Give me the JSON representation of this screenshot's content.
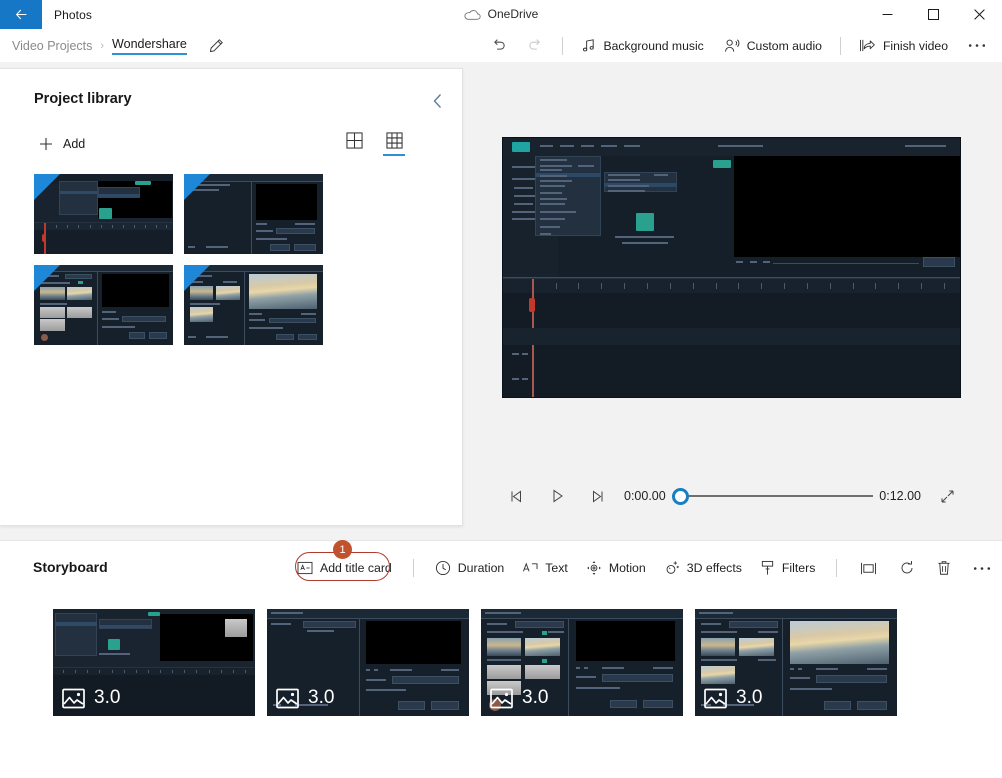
{
  "window": {
    "app_title": "Photos",
    "back_icon": "back-arrow-icon",
    "onedrive_label": "OneDrive",
    "onedrive_icon": "cloud-icon",
    "minimize_icon": "minimize-icon",
    "maximize_icon": "maximize-icon",
    "close_icon": "close-icon"
  },
  "commandbar": {
    "breadcrumb": {
      "parent": "Video Projects",
      "separator": "›",
      "current": "Wondershare",
      "edit_icon": "pencil-icon"
    },
    "undo_label": "Undo",
    "undo_icon": "undo-icon",
    "redo_label": "Redo",
    "redo_icon": "redo-icon",
    "background_music": "Background music",
    "background_music_icon": "music-note-icon",
    "custom_audio": "Custom audio",
    "custom_audio_icon": "person-audio-icon",
    "finish_video": "Finish video",
    "finish_video_icon": "share-export-icon",
    "more_label": "See more",
    "more_icon": "ellipsis-icon"
  },
  "library": {
    "title": "Project library",
    "collapse_icon": "chevron-left-icon",
    "add_label": "Add",
    "add_icon": "plus-icon",
    "views": [
      {
        "name": "large-grid-view",
        "icon": "grid-2x2-icon",
        "active": false
      },
      {
        "name": "small-grid-view",
        "icon": "grid-3x3-icon",
        "active": true
      }
    ],
    "items": [
      {
        "name": "project-thumb-1",
        "art": "editor-menu"
      },
      {
        "name": "project-thumb-2",
        "art": "import-dialog"
      },
      {
        "name": "project-thumb-3",
        "art": "device-import"
      },
      {
        "name": "project-thumb-4",
        "art": "sunset-import"
      }
    ]
  },
  "preview": {
    "art": "editor-menu-large",
    "current_time": "0:00.00",
    "total_time": "0:12.00",
    "progress_percent": 0,
    "prev_frame_icon": "previous-frame-icon",
    "play_icon": "play-icon",
    "next_frame_icon": "next-frame-icon",
    "fullscreen_icon": "fullscreen-icon"
  },
  "storyboard": {
    "title": "Storyboard",
    "tools": [
      {
        "name": "add-title-card-button",
        "label": "Add title card",
        "icon": "title-card-icon",
        "highlighted": true
      },
      {
        "name": "duration-button",
        "label": "Duration",
        "icon": "clock-icon"
      },
      {
        "name": "text-button",
        "label": "Text",
        "icon": "text-icon"
      },
      {
        "name": "motion-button",
        "label": "Motion",
        "icon": "motion-icon"
      },
      {
        "name": "3d-effects-button",
        "label": "3D effects",
        "icon": "sparkle-icon"
      },
      {
        "name": "filters-button",
        "label": "Filters",
        "icon": "brush-icon"
      },
      {
        "name": "resize-button",
        "label": "",
        "icon": "crop-resize-icon"
      },
      {
        "name": "rotate-button",
        "label": "",
        "icon": "rotate-icon"
      },
      {
        "name": "delete-button",
        "label": "",
        "icon": "trash-icon"
      },
      {
        "name": "more-options-button",
        "label": "",
        "icon": "ellipsis-icon"
      }
    ],
    "annotation": {
      "badge": "1",
      "color": "#b03a2e",
      "target": "add-title-card-button"
    },
    "clips": [
      {
        "name": "storyboard-clip-1",
        "duration": "3.0",
        "icon": "image-icon",
        "selected": true,
        "art": "editor-menu"
      },
      {
        "name": "storyboard-clip-2",
        "duration": "3.0",
        "icon": "image-icon",
        "selected": false,
        "art": "import-dialog"
      },
      {
        "name": "storyboard-clip-3",
        "duration": "3.0",
        "icon": "image-icon",
        "selected": false,
        "art": "device-import"
      },
      {
        "name": "storyboard-clip-4",
        "duration": "3.0",
        "icon": "image-icon",
        "selected": false,
        "art": "sunset-import"
      }
    ]
  },
  "colors": {
    "accent": "#2f8fd4",
    "back_button": "#1577c6",
    "annotation": "#b03a2e",
    "badge": "#c0522e",
    "panel_bg": "#ffffff",
    "app_bg": "#f2f2f2"
  }
}
